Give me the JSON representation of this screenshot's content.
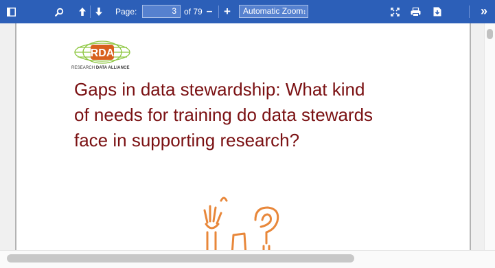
{
  "toolbar": {
    "page_label": "Page:",
    "page_number": "3",
    "page_count_text": "of 79",
    "zoom_value": "Automatic Zoom",
    "zoom_arrow": "↕",
    "zoom_out_glyph": "–",
    "zoom_in_glyph": "+",
    "more_glyph": "»",
    "icons": [
      "sidebar-toggle-icon",
      "search-icon",
      "previous-page-icon",
      "next-page-icon",
      "presentation-mode-icon",
      "print-icon",
      "download-icon",
      "tools-icon"
    ]
  },
  "document": {
    "logo_text": "RDA",
    "logo_caption_light": "RESEARCH",
    "logo_caption_bold": "DATA ALLIANCE",
    "title_lines": [
      "Gaps in data stewardship: What kind",
      "of needs for training do data stewards",
      "face in supporting research?"
    ]
  },
  "colors": {
    "toolbar_bg": "#2c5fb8",
    "title": "#7a1012",
    "doodle": "#e8873a",
    "logo_green": "#8cc63f"
  }
}
